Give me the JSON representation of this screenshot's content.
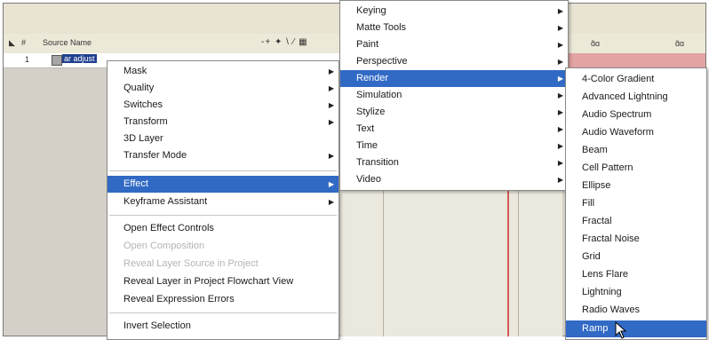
{
  "layer_panel": {
    "col_num": "#",
    "col_source": "Source Name",
    "row_index": "1",
    "row_name": "ar adjust",
    "header_icons": "-+ ✦ \\ ⁄ ▦"
  },
  "timeline": {
    "header_icons": [
      "ɑ̃ɑ",
      "ɑ̃ɑ"
    ]
  },
  "context_menu": {
    "items": [
      {
        "label": "Mask",
        "submenu": true
      },
      {
        "label": "Quality",
        "submenu": true
      },
      {
        "label": "Switches",
        "submenu": true
      },
      {
        "label": "Transform",
        "submenu": true
      },
      {
        "label": "3D Layer",
        "submenu": false
      },
      {
        "label": "Transfer Mode",
        "submenu": true
      },
      {
        "label": "Effect",
        "submenu": true
      },
      {
        "label": "Keyframe Assistant",
        "submenu": true
      },
      {
        "label": "Open Effect Controls",
        "submenu": false
      },
      {
        "label": "Open Composition",
        "submenu": false
      },
      {
        "label": "Reveal Layer Source in Project",
        "submenu": false
      },
      {
        "label": "Reveal Layer in Project Flowchart View",
        "submenu": false
      },
      {
        "label": "Reveal Expression Errors",
        "submenu": false
      },
      {
        "label": "Invert Selection",
        "submenu": false
      }
    ]
  },
  "effect_menu": {
    "items": [
      {
        "label": "Keying"
      },
      {
        "label": "Matte Tools"
      },
      {
        "label": "Paint"
      },
      {
        "label": "Perspective"
      },
      {
        "label": "Render"
      },
      {
        "label": "Simulation"
      },
      {
        "label": "Stylize"
      },
      {
        "label": "Text"
      },
      {
        "label": "Time"
      },
      {
        "label": "Transition"
      },
      {
        "label": "Video"
      }
    ]
  },
  "render_menu": {
    "items": [
      {
        "label": "4-Color Gradient"
      },
      {
        "label": "Advanced Lightning"
      },
      {
        "label": "Audio Spectrum"
      },
      {
        "label": "Audio Waveform"
      },
      {
        "label": "Beam"
      },
      {
        "label": "Cell Pattern"
      },
      {
        "label": "Ellipse"
      },
      {
        "label": "Fill"
      },
      {
        "label": "Fractal"
      },
      {
        "label": "Fractal Noise"
      },
      {
        "label": "Grid"
      },
      {
        "label": "Lens Flare"
      },
      {
        "label": "Lightning"
      },
      {
        "label": "Radio Waves"
      },
      {
        "label": "Ramp"
      }
    ]
  },
  "colors": {
    "menu_highlight": "#316ac5",
    "timeline_bar": "#e3a3a3",
    "current_time_line": "#d65a5a"
  }
}
